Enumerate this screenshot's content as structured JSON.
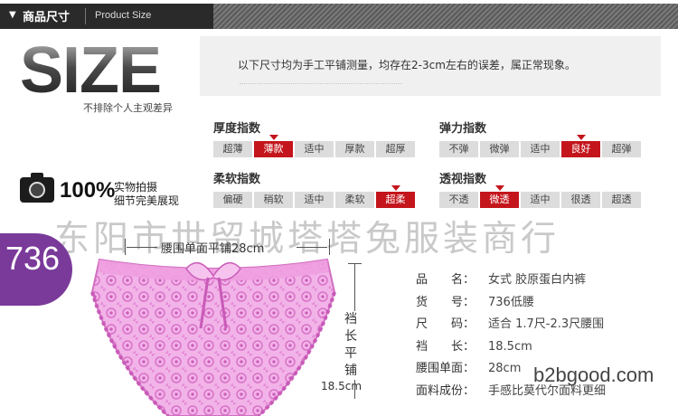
{
  "header": {
    "arrow": "▼",
    "title": "商品尺寸",
    "subtitle": "Product Size"
  },
  "size_logo": {
    "word": "SIZE",
    "note": "不排除个人主观差异"
  },
  "notice": "以下尺寸均为手工平铺测量，均存在2-3cm左右的误差，属正常现象。",
  "photo": {
    "percent": "100%",
    "line1": "实物拍摄",
    "line2": "细节完美展现"
  },
  "indicators": [
    {
      "title": "厚度指数",
      "options": [
        "超薄",
        "薄款",
        "适中",
        "厚款",
        "超厚"
      ],
      "selected": 1
    },
    {
      "title": "弹力指数",
      "options": [
        "不弹",
        "微弹",
        "适中",
        "良好",
        "超弹"
      ],
      "selected": 3
    },
    {
      "title": "柔软指数",
      "options": [
        "偏硬",
        "稍软",
        "适中",
        "柔软",
        "超柔"
      ],
      "selected": 4
    },
    {
      "title": "透视指数",
      "options": [
        "不透",
        "微透",
        "适中",
        "很透",
        "超透"
      ],
      "selected": 1
    }
  ],
  "watermark": "东阳市世留城塔塔兔服装商行",
  "product": {
    "number": "736",
    "waist_label": "腰围单面平铺28cm",
    "rise_label": [
      "裆",
      "长",
      "平",
      "铺"
    ],
    "rise_value": "18.5cm"
  },
  "specs": [
    {
      "key": "品　　名：",
      "value": "女式 胶原蛋白内裤"
    },
    {
      "key": "货　　号：",
      "value": "736低腰"
    },
    {
      "key": "尺　　码：",
      "value": "适合 1.7尺-2.3尺腰围"
    },
    {
      "key": "裆　　长：",
      "value": "18.5cm"
    },
    {
      "key": "腰围单面：",
      "value": "28cm"
    },
    {
      "key": "面料成份：",
      "value": "手感比莫代尔面料更细"
    }
  ],
  "brand_watermark": "b2bgood.com",
  "colors": {
    "accent_red": "#c4151c",
    "badge_purple": "#7a3a9a",
    "garment_pink": "#ef9fe0"
  }
}
